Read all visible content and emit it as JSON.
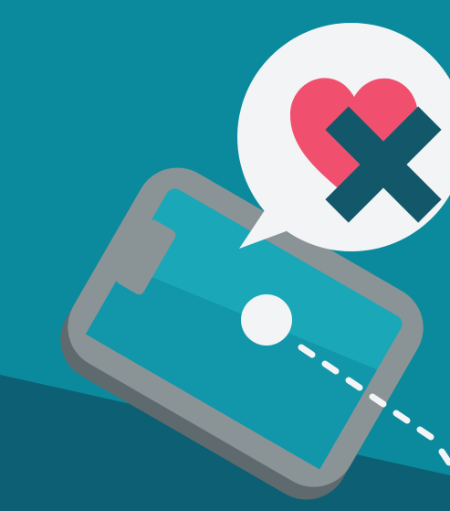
{
  "scene": {
    "description_label": "",
    "colors": {
      "background": "#0a8a9c",
      "background_dark": "#0d5f73",
      "phone_body": "#8a9497",
      "phone_body_shadow": "#5f6a6e",
      "phone_screen": "#1aa7b8",
      "phone_screen_shade": "#1296aa",
      "bubble": "#f2f4f5",
      "heart": "#f0506e",
      "cross": "#13586a",
      "touch_point": "#f2f4f5",
      "dashes": "#f2f4f5"
    },
    "icons": {
      "speech_bubble": "speech-bubble-icon",
      "heart": "heart-icon",
      "cross": "cross-icon",
      "phone": "smartphone-icon",
      "touch": "touch-point-icon"
    }
  }
}
